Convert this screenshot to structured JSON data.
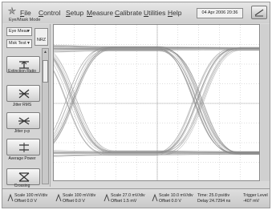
{
  "menu": {
    "items": [
      "File",
      "Control",
      "Setup",
      "Measure",
      "Calibrate",
      "Utilities",
      "Help"
    ],
    "datetime": "04 Apr 2006  20:36"
  },
  "mode": {
    "label": "Eye/Mask Mode"
  },
  "left_panel": {
    "dropdown_top": "Eye Meas",
    "dropdown_bottom": "Msk Test",
    "nrz_label": "NRZ",
    "buttons": [
      {
        "label": "Extinction Ratio",
        "icon": "extinction-ratio-icon"
      },
      {
        "label": "Jitter RMS",
        "icon": "jitter-rms-icon"
      },
      {
        "label": "Jitter p-p",
        "icon": "jitter-pp-icon"
      },
      {
        "label": "Average Power",
        "icon": "average-power-icon"
      },
      {
        "label": "Crossing",
        "icon": "crossing-icon"
      }
    ]
  },
  "status_bar": {
    "channels": [
      {
        "scale": "Scale 100 mV/div",
        "offset": "Offset 0.0 V"
      },
      {
        "scale": "Scale 100 mV/div",
        "offset": "Offset 0.0 V"
      },
      {
        "scale": "Scale 27.0 mV/div",
        "offset": "Offset 1.5 mV"
      },
      {
        "scale": "Scale 10.0 mV/div",
        "offset": "Offset 0.0 V"
      }
    ],
    "time": {
      "line1": "Time: 25.0 ps/div",
      "line2": "Delay 24.7294 ns"
    },
    "trigger": {
      "line1": "Trigger Level",
      "line2": "-407 mV"
    }
  },
  "colors": {
    "trace": "#8a8a8a",
    "grid": "#bcbcbc",
    "background": "#ffffff"
  }
}
